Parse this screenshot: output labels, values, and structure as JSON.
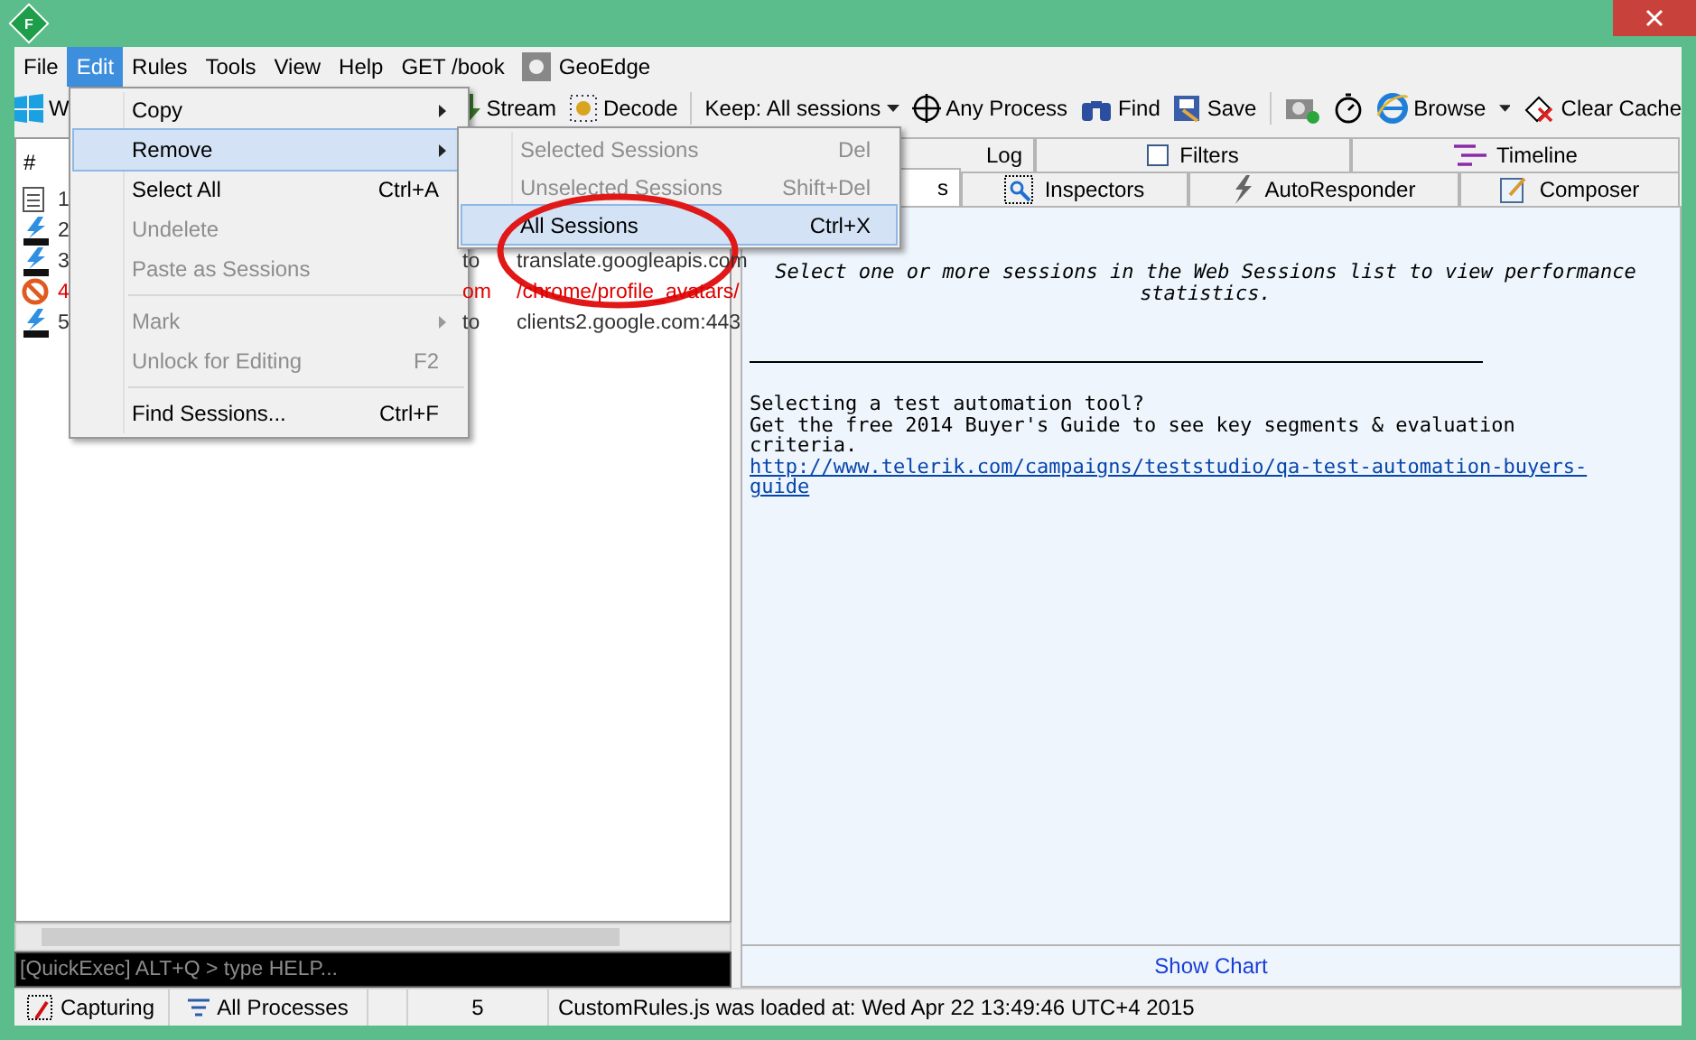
{
  "window": {
    "logo_letter": "F"
  },
  "menu_bar": [
    {
      "label": "File",
      "selected": false,
      "kind": "text"
    },
    {
      "label": "Edit",
      "selected": true,
      "kind": "text"
    },
    {
      "label": "Rules",
      "selected": false,
      "kind": "text"
    },
    {
      "label": "Tools",
      "selected": false,
      "kind": "text"
    },
    {
      "label": "View",
      "selected": false,
      "kind": "text"
    },
    {
      "label": "Help",
      "selected": false,
      "kind": "text"
    },
    {
      "label": "GET /book",
      "selected": false,
      "kind": "text"
    },
    {
      "label": "GeoEdge",
      "selected": false,
      "kind": "tool"
    }
  ],
  "toolbar": [
    {
      "kind": "button",
      "label": "W"
    },
    {
      "kind": "gap"
    },
    {
      "kind": "button",
      "label": "Stream"
    },
    {
      "kind": "button",
      "label": "Decode"
    },
    {
      "kind": "separator"
    },
    {
      "kind": "dropdown",
      "label": "Keep: All sessions"
    },
    {
      "kind": "button",
      "label": "Any Process"
    },
    {
      "kind": "button",
      "label": "Find"
    },
    {
      "kind": "button",
      "label": "Save"
    },
    {
      "kind": "separator"
    },
    {
      "kind": "icon"
    },
    {
      "kind": "icon"
    },
    {
      "kind": "button",
      "label": "Browse"
    },
    {
      "kind": "caret"
    },
    {
      "kind": "button",
      "label": "Clear Cache"
    }
  ],
  "sessions": {
    "header": "#",
    "rows": [
      {
        "kind": "doc",
        "number": "1",
        "error": false
      },
      {
        "kind": "http2",
        "number": "2",
        "error": false
      },
      {
        "kind": "http2",
        "number": "3",
        "error": false,
        "host": "to",
        "url": "translate.googleapis.com"
      },
      {
        "kind": "blocked",
        "number": "4",
        "error": true,
        "host": "om",
        "url": "/chrome/profile_avatars/"
      },
      {
        "kind": "http2",
        "number": "5",
        "error": false,
        "host": "to",
        "url": "clients2.google.com:443"
      }
    ]
  },
  "quickexec": {
    "placeholder": "[QuickExec] ALT+Q > type HELP..."
  },
  "tabs_top": [
    {
      "label": "Log",
      "selected": false
    },
    {
      "label": "Filters",
      "selected": false
    },
    {
      "label": "Timeline",
      "selected": false
    }
  ],
  "tabs_bottom": [
    {
      "label": "s",
      "selected": true
    },
    {
      "label": "Inspectors",
      "selected": false
    },
    {
      "label": "AutoResponder",
      "selected": false
    },
    {
      "label": "Composer",
      "selected": false
    }
  ],
  "statistics": {
    "message": "Select one or more sessions in the Web Sessions list to view performance statistics.",
    "promo": [
      "Selecting a test automation tool?",
      "Get the free 2014 Buyer's Guide to see key segments & evaluation criteria."
    ],
    "link": "http://www.telerik.com/campaigns/teststudio/qa-test-automation-buyers-guide",
    "show_chart": "Show Chart"
  },
  "edit_menu": [
    {
      "kind": "item",
      "label": "Copy",
      "submenu": true,
      "disabled": false,
      "selected": false
    },
    {
      "kind": "item",
      "label": "Remove",
      "submenu": true,
      "disabled": false,
      "selected": true
    },
    {
      "kind": "item",
      "label": "Select All",
      "shortcut": "Ctrl+A",
      "submenu": false,
      "disabled": false,
      "selected": false
    },
    {
      "kind": "item",
      "label": "Undelete",
      "submenu": false,
      "disabled": true,
      "selected": false
    },
    {
      "kind": "item",
      "label": "Paste as Sessions",
      "submenu": false,
      "disabled": true,
      "selected": false
    },
    {
      "kind": "separator"
    },
    {
      "kind": "item",
      "label": "Mark",
      "submenu": true,
      "disabled": true,
      "selected": false
    },
    {
      "kind": "item",
      "label": "Unlock for Editing",
      "shortcut": "F2",
      "submenu": false,
      "disabled": true,
      "selected": false
    },
    {
      "kind": "separator"
    },
    {
      "kind": "item",
      "label": "Find Sessions...",
      "shortcut": "Ctrl+F",
      "submenu": false,
      "disabled": false,
      "selected": false
    }
  ],
  "remove_submenu": [
    {
      "kind": "item",
      "label": "Selected Sessions",
      "shortcut": "Del",
      "submenu": false,
      "disabled": true,
      "selected": false
    },
    {
      "kind": "item",
      "label": "Unselected Sessions",
      "shortcut": "Shift+Del",
      "submenu": false,
      "disabled": true,
      "selected": false
    },
    {
      "kind": "item",
      "label": "All Sessions",
      "shortcut": "Ctrl+X",
      "submenu": false,
      "disabled": false,
      "selected": true
    }
  ],
  "status_bar": [
    {
      "kind": "capture",
      "label": "Capturing"
    },
    {
      "kind": "filter",
      "label": "All Processes"
    },
    {
      "kind": "blank"
    },
    {
      "kind": "count",
      "label": "5"
    },
    {
      "kind": "message",
      "label": "CustomRules.js was loaded at: Wed Apr 22 13:49:46 UTC+4 2015"
    }
  ]
}
